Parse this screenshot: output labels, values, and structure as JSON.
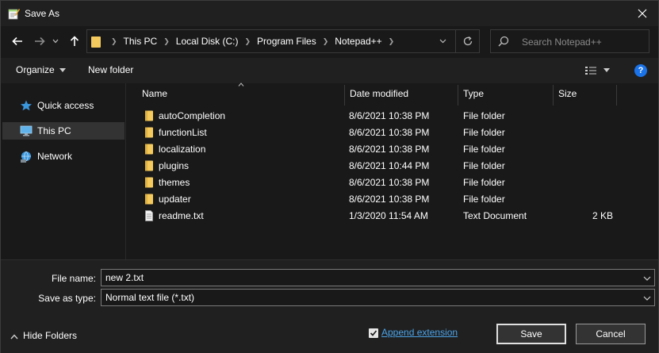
{
  "window": {
    "title": "Save As",
    "app_icon": "notepad-plus-plus-icon",
    "close_icon": "close-icon"
  },
  "address_bar": {
    "breadcrumbs": [
      "This PC",
      "Local Disk (C:)",
      "Program Files",
      "Notepad++"
    ],
    "refresh_icon": "refresh-icon"
  },
  "search": {
    "placeholder": "Search Notepad++"
  },
  "toolbar": {
    "organize_label": "Organize",
    "new_folder_label": "New folder",
    "view_icon": "view-options-icon",
    "help_icon": "help-icon",
    "help_glyph": "?"
  },
  "nav_pane": {
    "items": [
      {
        "label": "Quick access",
        "icon": "star-icon"
      },
      {
        "label": "This PC",
        "icon": "computer-icon"
      },
      {
        "label": "Network",
        "icon": "network-icon"
      }
    ],
    "selected": "This PC"
  },
  "file_list": {
    "columns": [
      "Name",
      "Date modified",
      "Type",
      "Size"
    ],
    "sorted_by": "Name",
    "rows": [
      {
        "name": "autoCompletion",
        "date": "8/6/2021 10:38 PM",
        "type": "File folder",
        "size": "",
        "icon": "folder-icon"
      },
      {
        "name": "functionList",
        "date": "8/6/2021 10:38 PM",
        "type": "File folder",
        "size": "",
        "icon": "folder-icon"
      },
      {
        "name": "localization",
        "date": "8/6/2021 10:38 PM",
        "type": "File folder",
        "size": "",
        "icon": "folder-icon"
      },
      {
        "name": "plugins",
        "date": "8/6/2021 10:44 PM",
        "type": "File folder",
        "size": "",
        "icon": "folder-icon"
      },
      {
        "name": "themes",
        "date": "8/6/2021 10:38 PM",
        "type": "File folder",
        "size": "",
        "icon": "folder-icon"
      },
      {
        "name": "updater",
        "date": "8/6/2021 10:38 PM",
        "type": "File folder",
        "size": "",
        "icon": "folder-icon"
      },
      {
        "name": "readme.txt",
        "date": "1/3/2020 11:54 AM",
        "type": "Text Document",
        "size": "2 KB",
        "icon": "text-file-icon"
      }
    ]
  },
  "form": {
    "file_name_label": "File name:",
    "file_name_value": "new 2.txt",
    "save_type_label": "Save as type:",
    "save_type_value": "Normal text file (*.txt)"
  },
  "footer": {
    "hide_folders_label": "Hide Folders",
    "append_extension_label": "Append extension",
    "append_extension_checked": true,
    "save_label": "Save",
    "cancel_label": "Cancel"
  },
  "colors": {
    "background": "#191919",
    "titlebar": "#202020",
    "folder": "#f4c95d",
    "link": "#4aa3e8",
    "help_blue": "#1a73e8"
  }
}
